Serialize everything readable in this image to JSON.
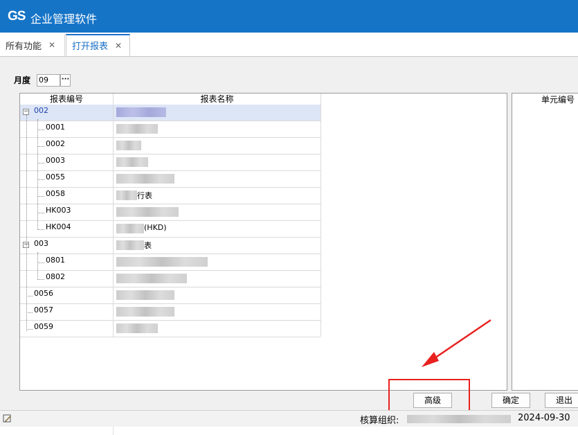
{
  "app": {
    "logo": "GS",
    "title": "企业管理软件"
  },
  "tabs": [
    {
      "label": "所有功能",
      "close": "✕",
      "active": false
    },
    {
      "label": "打开报表",
      "close": "✕",
      "active": true
    }
  ],
  "month": {
    "label": "月度",
    "value": "09",
    "button": "···"
  },
  "grid": {
    "headers": {
      "code": "报表编号",
      "name": "报表名称",
      "unit": "单元编号"
    },
    "rows": [
      {
        "code": "002",
        "name": "",
        "level": 0,
        "expanded": true,
        "selected": true
      },
      {
        "code": "0001",
        "name": "",
        "level": 1
      },
      {
        "code": "0002",
        "name": "",
        "level": 1
      },
      {
        "code": "0003",
        "name": "",
        "level": 1
      },
      {
        "code": "0055",
        "name": "",
        "level": 1
      },
      {
        "code": "0058",
        "name": "行表",
        "level": 1
      },
      {
        "code": "HK003",
        "name": "",
        "level": 1
      },
      {
        "code": "HK004",
        "name": "(HKD)",
        "level": 1
      },
      {
        "code": "003",
        "name": "表",
        "level": 0,
        "expanded": true
      },
      {
        "code": "0801",
        "name": "",
        "level": 1
      },
      {
        "code": "0802",
        "name": "",
        "level": 1
      },
      {
        "code": "0056",
        "name": "",
        "level": 0
      },
      {
        "code": "0057",
        "name": "",
        "level": 0
      },
      {
        "code": "0059",
        "name": "",
        "level": 0
      }
    ]
  },
  "buttons": {
    "advanced": "高级",
    "ok": "确定",
    "exit": "退出"
  },
  "status": {
    "org_label": "核算组织:",
    "date": "2024-09-30"
  },
  "colors": {
    "titlebar": "#1674c7",
    "accent": "#1a6fc6",
    "highlight": "#e8211f",
    "arrow": "#e8211f"
  }
}
